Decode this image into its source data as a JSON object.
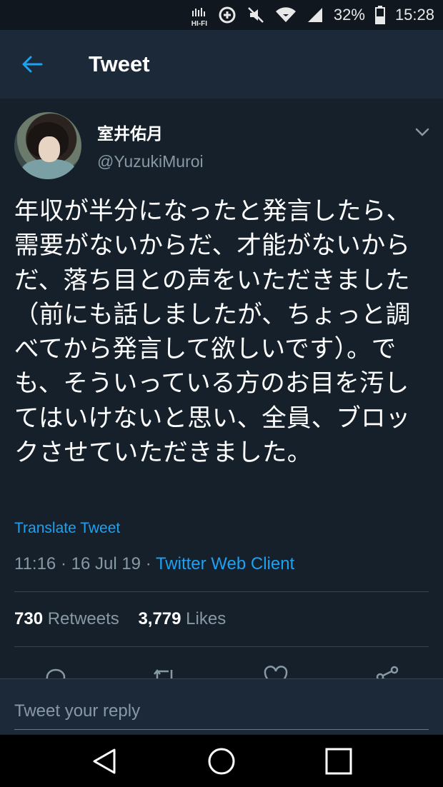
{
  "status_bar": {
    "hifi_label": "HI-FI",
    "battery_percent": "32%",
    "time": "15:28",
    "icons": [
      "hifi-icon",
      "data-saver-icon",
      "mute-icon",
      "wifi-icon",
      "signal-icon",
      "battery-icon"
    ]
  },
  "header": {
    "title": "Tweet",
    "back_icon": "back-arrow-icon"
  },
  "tweet": {
    "display_name": "室井佑月",
    "handle": "@YuzukiMuroi",
    "text": "年収が半分になったと発言したら、需要がないからだ、才能がないからだ、落ち目との声をいただきました（前にも話しましたが、ちょっと調べてから発言して欲しいです）。でも、そういっている方のお目を汚してはいけないと思い、全員、ブロックさせていただきました。",
    "translate_label": "Translate Tweet",
    "time": "11:16",
    "date": "16 Jul 19",
    "separator": "·",
    "client": "Twitter Web Client",
    "retweets_count": "730",
    "retweets_label": "Retweets",
    "likes_count": "3,779",
    "likes_label": "Likes"
  },
  "actions": [
    "reply-icon",
    "retweet-icon",
    "like-icon",
    "share-icon"
  ],
  "reply": {
    "placeholder": "Tweet your reply"
  },
  "nav": [
    "nav-back-icon",
    "nav-home-icon",
    "nav-recents-icon"
  ],
  "colors": {
    "background": "#15202b",
    "header": "#1c2938",
    "accent": "#1da1f2",
    "secondary_text": "#8899a6",
    "divider": "#38444d"
  }
}
